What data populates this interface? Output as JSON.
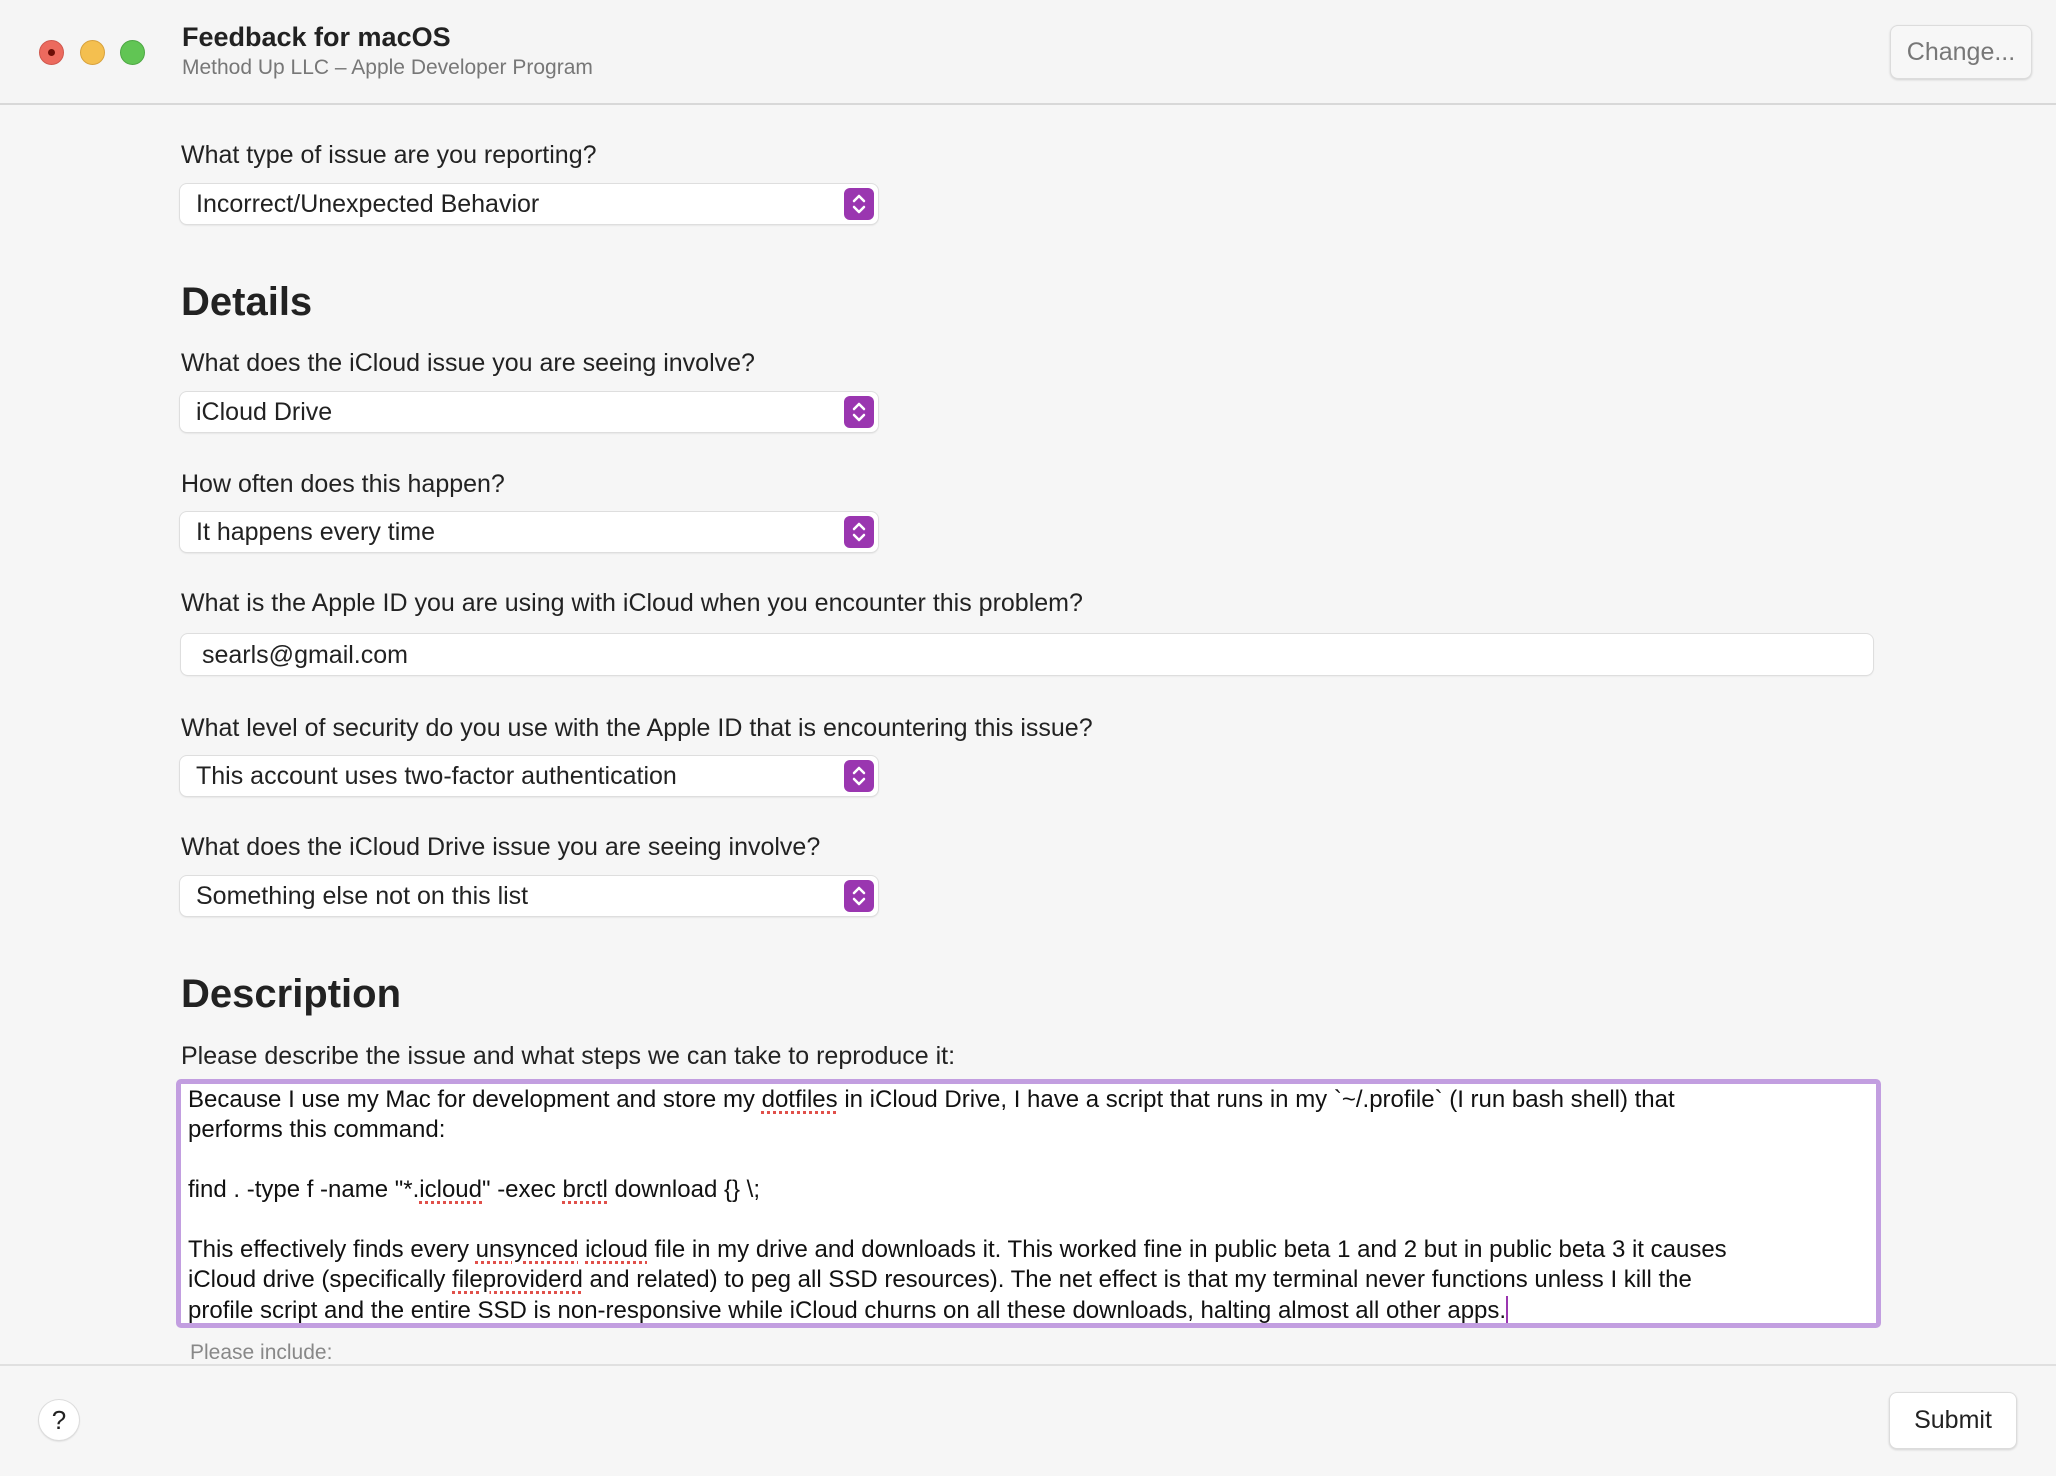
{
  "window": {
    "title": "Feedback for macOS",
    "subtitle": "Method Up LLC – Apple Developer Program",
    "change_label": "Change..."
  },
  "colors": {
    "accent": "#9a36b0",
    "focus_ring": "#c29ee0"
  },
  "form": {
    "issue_type": {
      "label": "What type of issue are you reporting?",
      "value": "Incorrect/Unexpected Behavior"
    },
    "details_heading": "Details",
    "involve": {
      "label": "What does the iCloud issue you are seeing involve?",
      "value": "iCloud Drive"
    },
    "frequency": {
      "label": "How often does this happen?",
      "value": "It happens every time"
    },
    "apple_id": {
      "label": "What is the Apple ID you are using with iCloud when you encounter this problem?",
      "value": "searls@gmail.com"
    },
    "security": {
      "label": "What level of security do you use with the Apple ID that is encountering this issue?",
      "value": "This account uses two-factor authentication"
    },
    "drive_issue": {
      "label": "What does the iCloud Drive issue you are seeing involve?",
      "value": "Something else not on this list"
    },
    "description_heading": "Description",
    "description": {
      "label": "Please describe the issue and what steps we can take to reproduce it:",
      "lines": [
        [
          {
            "t": "Because I use my Mac for development and store my "
          },
          {
            "t": "dotfiles",
            "err": true
          },
          {
            "t": " in iCloud Drive, I have a script that runs in my `~/.profile` (I run bash shell) that"
          }
        ],
        [
          {
            "t": "performs this command:"
          }
        ],
        [],
        [
          {
            "t": "find . -type f -name \"*."
          },
          {
            "t": "icloud",
            "err": true
          },
          {
            "t": "\" -exec "
          },
          {
            "t": "brctl",
            "err": true
          },
          {
            "t": " download {} \\;"
          }
        ],
        [],
        [
          {
            "t": "This effectively finds every "
          },
          {
            "t": "unsynced",
            "err": true
          },
          {
            "t": " "
          },
          {
            "t": "icloud",
            "err": true
          },
          {
            "t": " file in my drive and downloads it. This worked fine in public beta 1 and 2 but in public beta 3 it causes"
          }
        ],
        [
          {
            "t": "iCloud drive (specifically "
          },
          {
            "t": "fileproviderd",
            "err": true
          },
          {
            "t": " and related) to peg all SSD resources). The net effect is that my terminal never functions unless I kill the"
          }
        ],
        [
          {
            "t": "profile script and the entire SSD is non-responsive while iCloud churns on all these downloads, halting almost all other apps."
          }
        ]
      ],
      "hint": "Please include:"
    }
  },
  "footer": {
    "help_label": "?",
    "submit_label": "Submit"
  }
}
